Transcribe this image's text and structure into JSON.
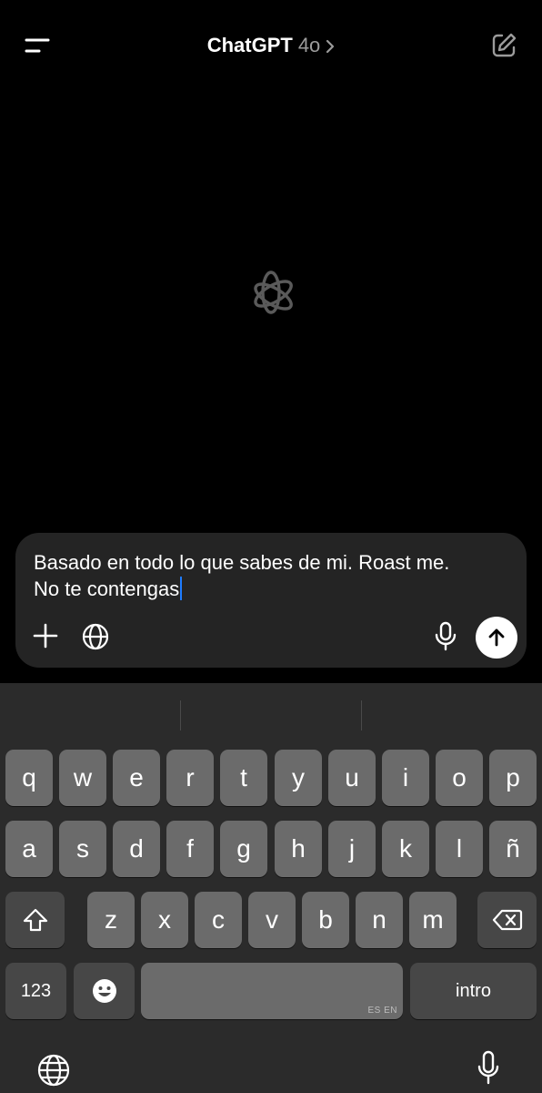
{
  "header": {
    "title": "ChatGPT",
    "model": "4o"
  },
  "composer": {
    "line1": "Basado en todo lo que sabes de mi. Roast me.",
    "line2": "No te contengas"
  },
  "keyboard": {
    "row1": [
      "q",
      "w",
      "e",
      "r",
      "t",
      "y",
      "u",
      "i",
      "o",
      "p"
    ],
    "row2": [
      "a",
      "s",
      "d",
      "f",
      "g",
      "h",
      "j",
      "k",
      "l",
      "ñ"
    ],
    "row3": [
      "z",
      "x",
      "c",
      "v",
      "b",
      "n",
      "m"
    ],
    "numbers_label": "123",
    "space_hint": "ES EN",
    "return_label": "intro"
  },
  "icons": {
    "menu": "menu-icon",
    "new_chat": "edit-icon",
    "logo": "openai-logo",
    "plus": "plus-icon",
    "web": "globe-icon",
    "mic": "microphone-icon",
    "send": "arrow-up-icon",
    "shift": "shift-icon",
    "delete": "backspace-icon",
    "emoji": "emoji-icon",
    "keyboard_globe": "globe-icon",
    "dictation": "microphone-icon"
  },
  "colors": {
    "background": "#000000",
    "composer": "#242424",
    "keyboard": "#2b2b2b",
    "key": "#6b6b6b",
    "key_dark": "#474747",
    "caret": "#1e7cff"
  }
}
